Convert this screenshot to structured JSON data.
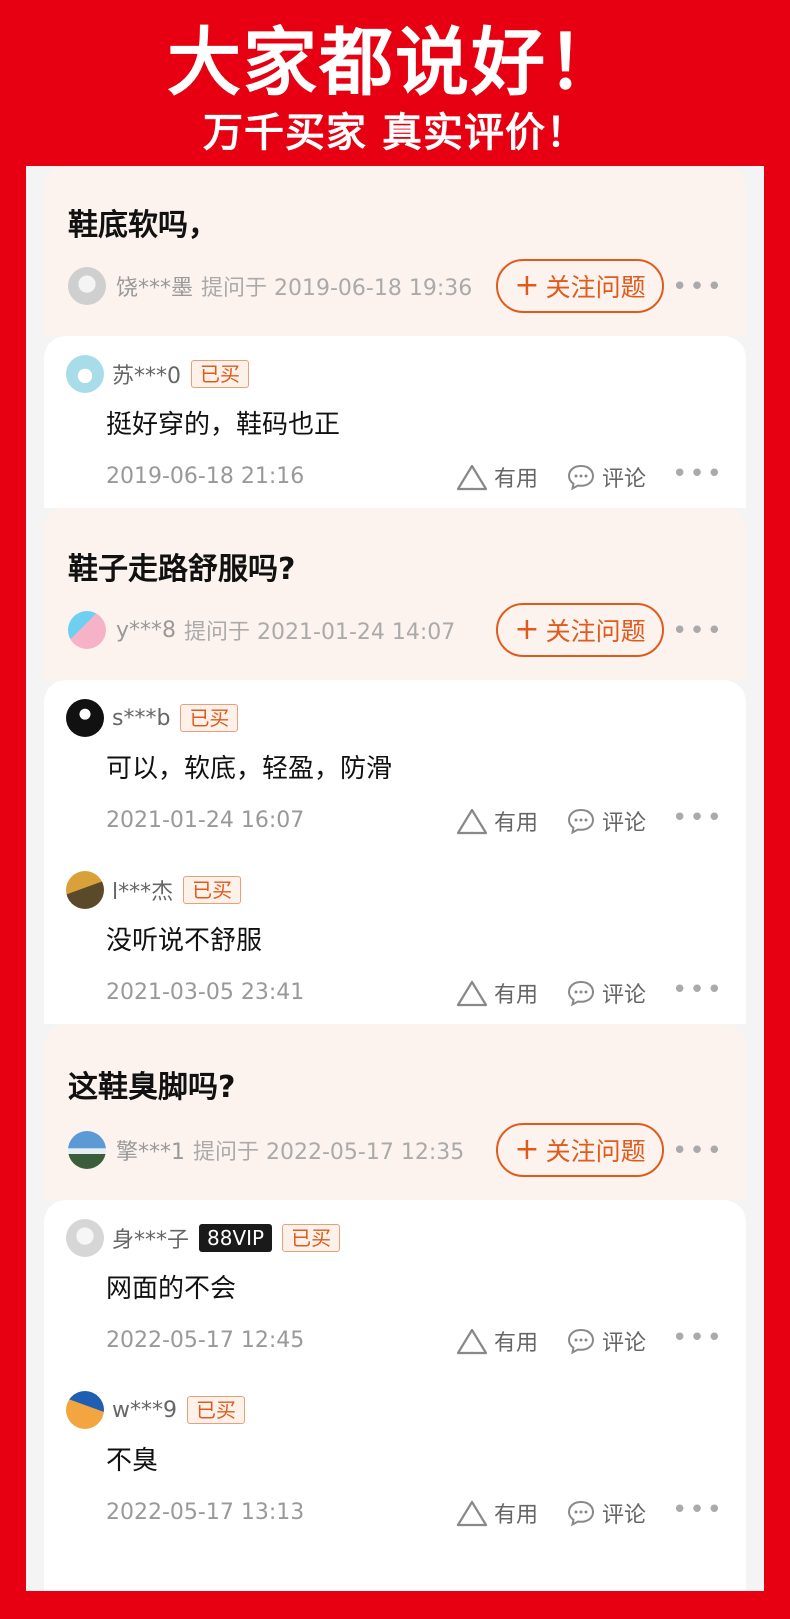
{
  "banner": {
    "title": "大家都说好！",
    "subtitle": "万千买家 真实评价！"
  },
  "labels": {
    "follow": "关注问题",
    "useful": "有用",
    "comment": "评论",
    "bought": "已买",
    "more": "•••"
  },
  "questions": [
    {
      "title": "鞋底软吗，",
      "user": "饶***墨",
      "asked": "提问于 2019-06-18 19:36",
      "answers": [
        {
          "user": "苏***0",
          "text": "挺好穿的，鞋码也正",
          "time": "2019-06-18 21:16"
        }
      ]
    },
    {
      "title": "鞋子走路舒服吗?",
      "user": "y***8",
      "asked": "提问于 2021-01-24 14:07",
      "answers": [
        {
          "user": "s***b",
          "text": "可以，软底，轻盈，防滑",
          "time": "2021-01-24 16:07"
        },
        {
          "user": "l***杰",
          "text": "没听说不舒服",
          "time": "2021-03-05 23:41"
        }
      ]
    },
    {
      "title": "这鞋臭脚吗?",
      "user": "擎***1",
      "asked": "提问于 2022-05-17 12:35",
      "answers": [
        {
          "user": "身***子",
          "vip": "88VIP",
          "text": "网面的不会",
          "time": "2022-05-17 12:45"
        },
        {
          "user": "w***9",
          "text": "不臭",
          "time": "2022-05-17 13:13"
        }
      ]
    }
  ],
  "colors": {
    "background": "#e60012",
    "accent": "#e05a1c",
    "question_bg": "#fcf3ef"
  }
}
